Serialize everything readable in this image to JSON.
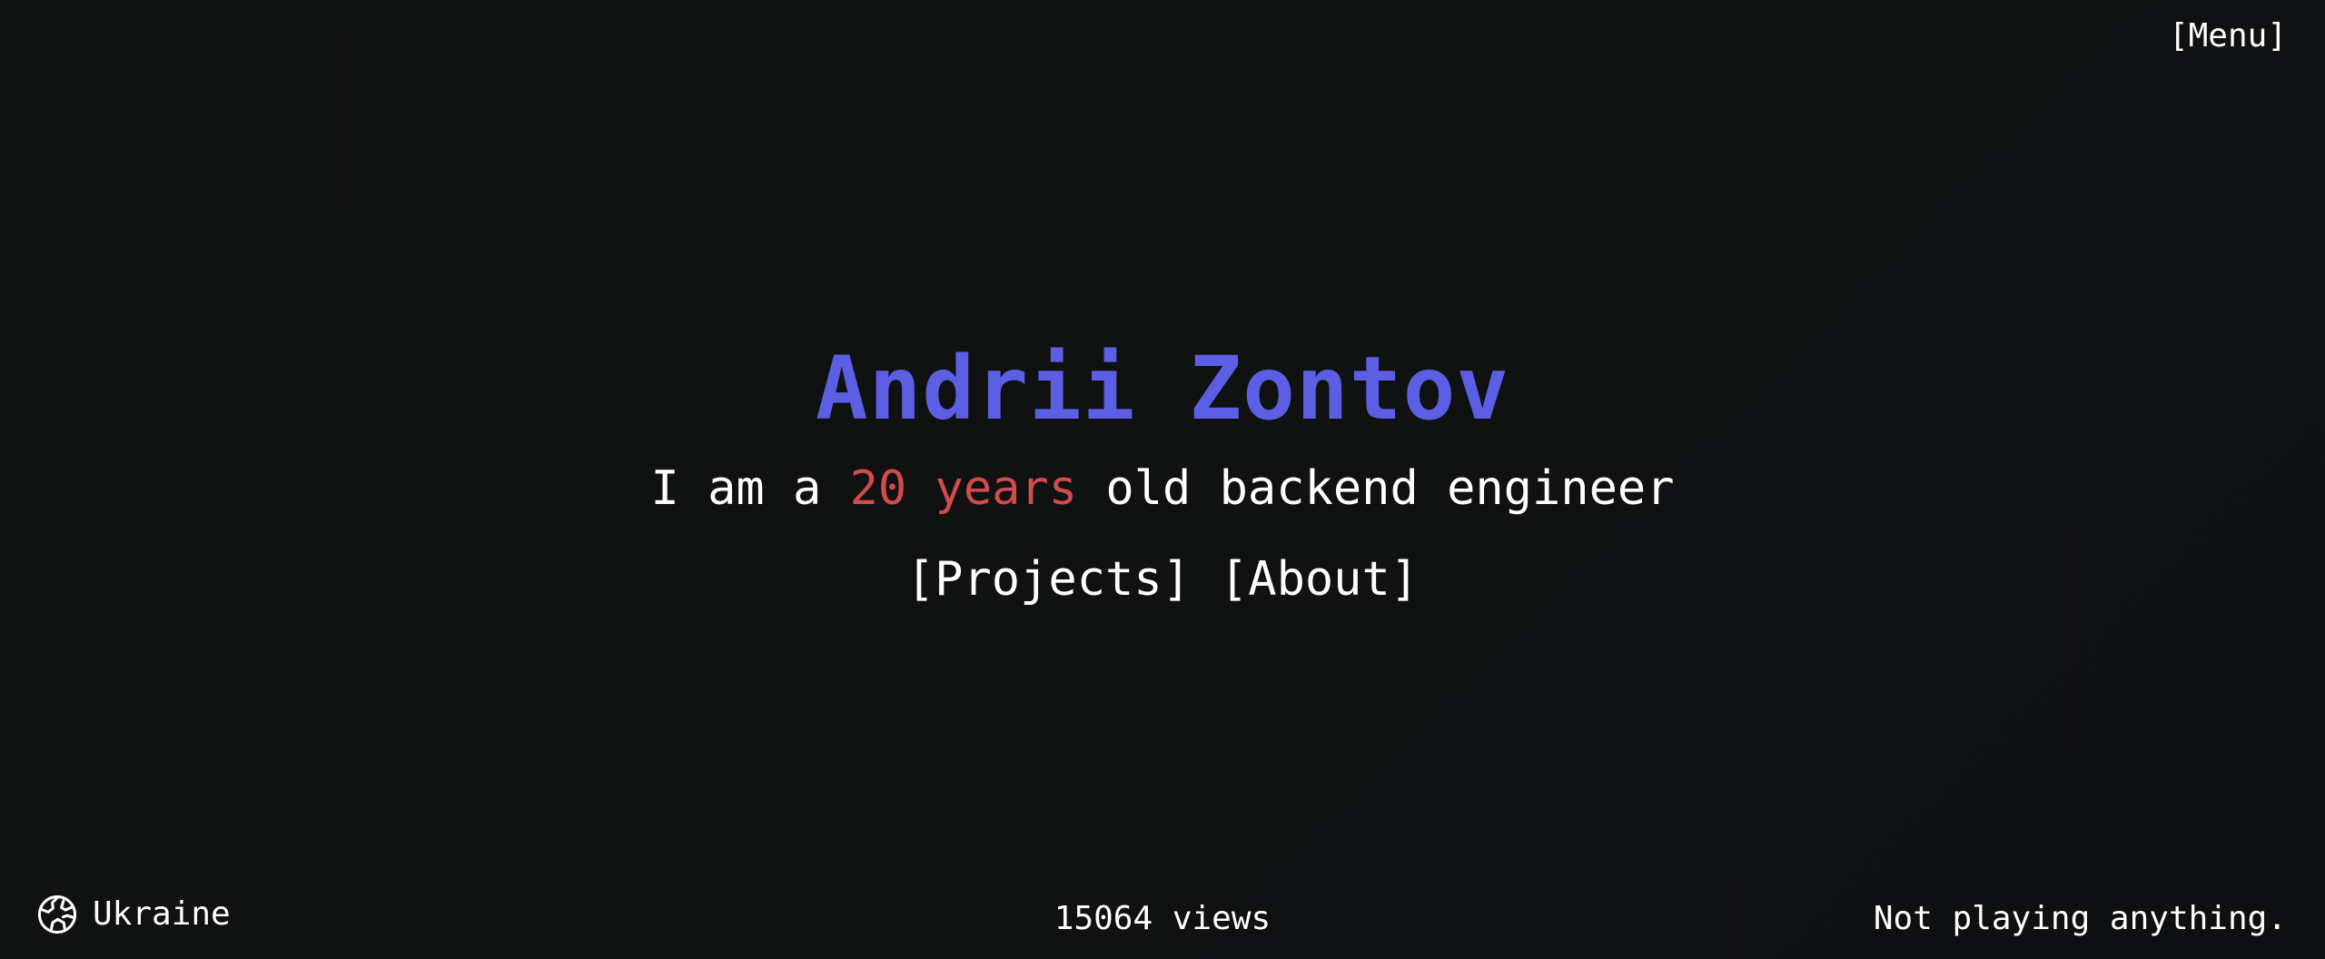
{
  "header": {
    "menu_label": "[Menu]"
  },
  "hero": {
    "name": "Andrii Zontov",
    "tagline_prefix": "I am a ",
    "tagline_highlight": "20 years",
    "tagline_suffix": " old backend engineer"
  },
  "nav": {
    "projects_label": "[Projects]",
    "about_label": "[About]"
  },
  "footer": {
    "location": "Ukraine",
    "location_icon": "globe-icon",
    "views": "15064 views",
    "now_playing": "Not playing anything."
  },
  "colors": {
    "name": "#5c5fe3",
    "highlight": "#d34c4c",
    "text": "#ffffff",
    "background": "#111213"
  }
}
